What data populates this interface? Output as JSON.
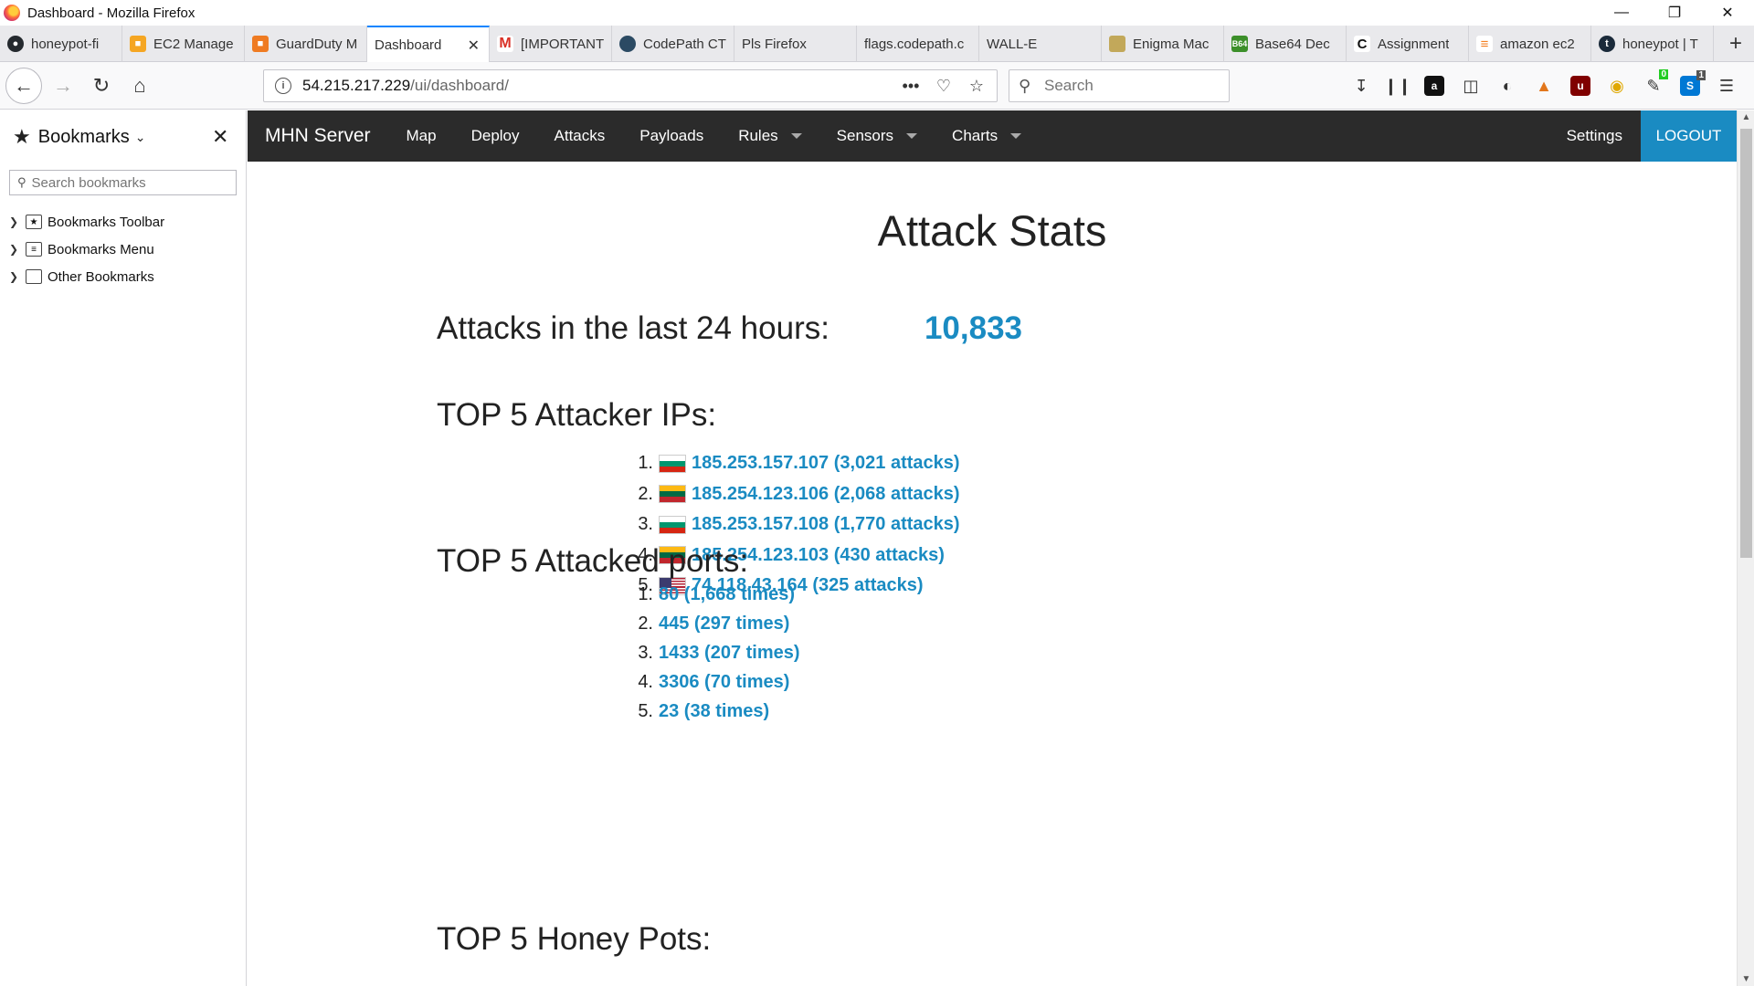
{
  "window": {
    "title": "Dashboard - Mozilla Firefox",
    "controls": [
      "minimize-icon",
      "restore-icon",
      "close-icon"
    ]
  },
  "tabs": [
    {
      "label": "honeypot-fi",
      "icon": "github-icon",
      "color": "#24292e"
    },
    {
      "label": "EC2 Manage",
      "icon": "aws-cube-icon",
      "color": "#f5a623"
    },
    {
      "label": "GuardDuty M",
      "icon": "aws-cube-icon",
      "color": "#ef7b22"
    },
    {
      "label": "Dashboard",
      "icon": "",
      "color": "",
      "active": true
    },
    {
      "label": "[IMPORTANT",
      "icon": "gmail-icon",
      "color": "#d93025"
    },
    {
      "label": "CodePath CT",
      "icon": "globe-icon",
      "color": "#2b4a63"
    },
    {
      "label": "Pls Firefox",
      "icon": "",
      "color": ""
    },
    {
      "label": "flags.codepath.c",
      "icon": "",
      "color": ""
    },
    {
      "label": "WALL-E",
      "icon": "",
      "color": ""
    },
    {
      "label": "Enigma Mac",
      "icon": "machine-icon",
      "color": "#c2a85a"
    },
    {
      "label": "Base64 Dec",
      "icon": "b64-icon",
      "color": "#3c8f2a"
    },
    {
      "label": "Assignment",
      "icon": "codepath-icon",
      "color": "#111111"
    },
    {
      "label": "amazon ec2",
      "icon": "stackoverflow-icon",
      "color": "#f48024"
    },
    {
      "label": "honeypot | T",
      "icon": "tumblr-icon",
      "color": "#1a2a3a"
    }
  ],
  "toolbar": {
    "url_host": "54.215.217.229",
    "url_path": "/ui/dashboard/",
    "search_placeholder": "Search",
    "ext_badge_1": "0",
    "ext_badge_2": "1"
  },
  "sidebar": {
    "title": "Bookmarks",
    "search_placeholder": "Search bookmarks",
    "items": [
      "Bookmarks Toolbar",
      "Bookmarks Menu",
      "Other Bookmarks"
    ]
  },
  "appnav": {
    "brand": "MHN Server",
    "links": [
      "Map",
      "Deploy",
      "Attacks",
      "Payloads"
    ],
    "dropdowns": [
      "Rules",
      "Sensors",
      "Charts"
    ],
    "settings": "Settings",
    "logout": "LOGOUT"
  },
  "dashboard": {
    "title": "Attack Stats",
    "attacks_label": "Attacks in the last 24 hours:",
    "attacks_value": "10,833",
    "top_ips_heading": "TOP 5 Attacker IPs:",
    "top_ips": [
      {
        "rank": "1.",
        "text": "185.253.157.107 (3,021 attacks)",
        "flag": [
          "#ffffff",
          "#00966e",
          "#d62612"
        ]
      },
      {
        "rank": "2.",
        "text": "185.254.123.106 (2,068 attacks)",
        "flag": [
          "#fdb913",
          "#006a44",
          "#c1272d"
        ]
      },
      {
        "rank": "3.",
        "text": "185.253.157.108 (1,770 attacks)",
        "flag": [
          "#ffffff",
          "#00966e",
          "#d62612"
        ]
      },
      {
        "rank": "4.",
        "text": "185.254.123.103 (430 attacks)",
        "flag": [
          "#fdb913",
          "#006a44",
          "#c1272d"
        ]
      },
      {
        "rank": "5.",
        "text": "74.118.43.164 (325 attacks)",
        "flag": "us"
      }
    ],
    "top_ports_heading": "TOP 5 Attacked ports:",
    "top_ports": [
      {
        "rank": "1.",
        "text": "80 (1,668 times)"
      },
      {
        "rank": "2.",
        "text": "445 (297 times)"
      },
      {
        "rank": "3.",
        "text": "1433 (207 times)"
      },
      {
        "rank": "4.",
        "text": "3306 (70 times)"
      },
      {
        "rank": "5.",
        "text": "23 (38 times)"
      }
    ],
    "top_honeypots_heading": "TOP 5 Honey Pots:"
  },
  "colors": {
    "accent": "#1a8bc2",
    "navbar_bg": "#2b2b2b"
  }
}
